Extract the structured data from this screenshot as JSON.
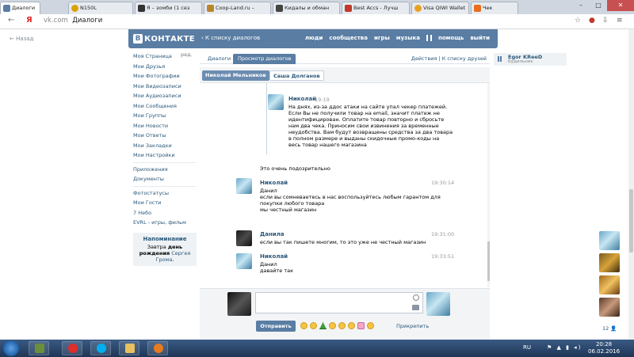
{
  "browser": {
    "tabs": [
      {
        "title": "Диалоги",
        "active": true,
        "color": "#597da3"
      },
      {
        "title": "N150L",
        "active": false,
        "color": "#d9a200"
      },
      {
        "title": "Я – зомби (1 сез",
        "active": false,
        "color": "#333333"
      },
      {
        "title": "Coop-Land.ru – ",
        "active": false,
        "color": "#b8862b"
      },
      {
        "title": "Кидалы и обман",
        "active": false,
        "color": "#444444"
      },
      {
        "title": "Best Accs - Лучш",
        "active": false,
        "color": "#c0392b"
      },
      {
        "title": "Visa QIWI Wallet",
        "active": false,
        "color": "#e8a11f"
      },
      {
        "title": "Чек",
        "active": false,
        "color": "#e86d1f"
      }
    ],
    "window_controls": {
      "minimize": "–",
      "maximize": "□",
      "close": "✕"
    },
    "url_host": "vk.com",
    "url_title": "Диалоги",
    "nav_glyphs": {
      "back": "←",
      "yandex": "Я"
    }
  },
  "vk": {
    "back_link": "← Назад",
    "logo_b": "В",
    "logo_text": "КОНТАКТЕ",
    "header_back": "‹ К списку диалогов",
    "top_nav": [
      "люди",
      "сообщества",
      "игры",
      "музыка",
      "помощь",
      "выйти"
    ],
    "left_menu": {
      "edit": "ред.",
      "main": [
        "Моя Страница",
        "Мои Друзья",
        "Мои Фотографии",
        "Мои Видеозаписи",
        "Мои Аудиозаписи",
        "Мои Сообщения",
        "Мои Группы",
        "Мои Новости",
        "Мои Ответы",
        "Мои Закладки",
        "Мои Настройки"
      ],
      "apps": [
        "Приложения",
        "Документы"
      ],
      "extra": [
        "Фотостатусы",
        "Мои Гости",
        "7 Небо",
        "EVRL - игры, фильм"
      ]
    },
    "reminder": {
      "title": "Напоминание",
      "prefix": "Завтра ",
      "bold": "день рождения",
      "name": "Сергея Грома",
      "suffix": "."
    },
    "tabs": {
      "dialogs": "Диалоги",
      "view": "Просмотр диалогов",
      "actions": "Действия",
      "to_friends": "К списку друзей"
    },
    "partners": {
      "selected": "Николай Мельников",
      "other": "Саша Долганов"
    },
    "messages": [
      {
        "type": "forwarded",
        "name": "Николай",
        "time": "19:19",
        "lines": [
          "На днях, из-за ддос атаки на сайте упал чекер платежей.",
          "Если Вы не получили товар на email, значит платеж не",
          "идентифицирован. Оплатите товар повторно и сбросьте",
          "нам два чека. Приносим свои извинения за временные",
          "неудобства. Вам будут возвращены средства за два товара",
          "в полном размере и выданы скидочные промо-коды на",
          "весь товар нашего магазина"
        ]
      },
      {
        "type": "text",
        "lines": [
          "Это очень подозрительно"
        ]
      },
      {
        "type": "msg",
        "name": "Николай",
        "time": "19:30:14",
        "lines": [
          "Данил",
          "",
          "если вы сомневаетесь в нас воспользуйтесь любым гарантом для",
          "покупки любого товара",
          "",
          "мы честный магазин"
        ]
      },
      {
        "type": "msg",
        "name": "Данила",
        "time": "19:31:00",
        "lines": [
          "если вы так пишете многим, то это уже не честный магазин"
        ]
      },
      {
        "type": "msg",
        "name": "Николай",
        "time": "19:33:51",
        "lines": [
          "Данил",
          "",
          "давайте так"
        ]
      }
    ],
    "composer": {
      "send": "Отправить",
      "attach": "Прикрепить"
    },
    "friend": {
      "name": "Egor KReeD",
      "status": "Будильник"
    },
    "friends_count": "12 👤"
  },
  "taskbar": {
    "lang": "RU",
    "tray": "⚑ ▲ ▮ ◂)",
    "time": "20:28",
    "date": "06.02.2016"
  }
}
